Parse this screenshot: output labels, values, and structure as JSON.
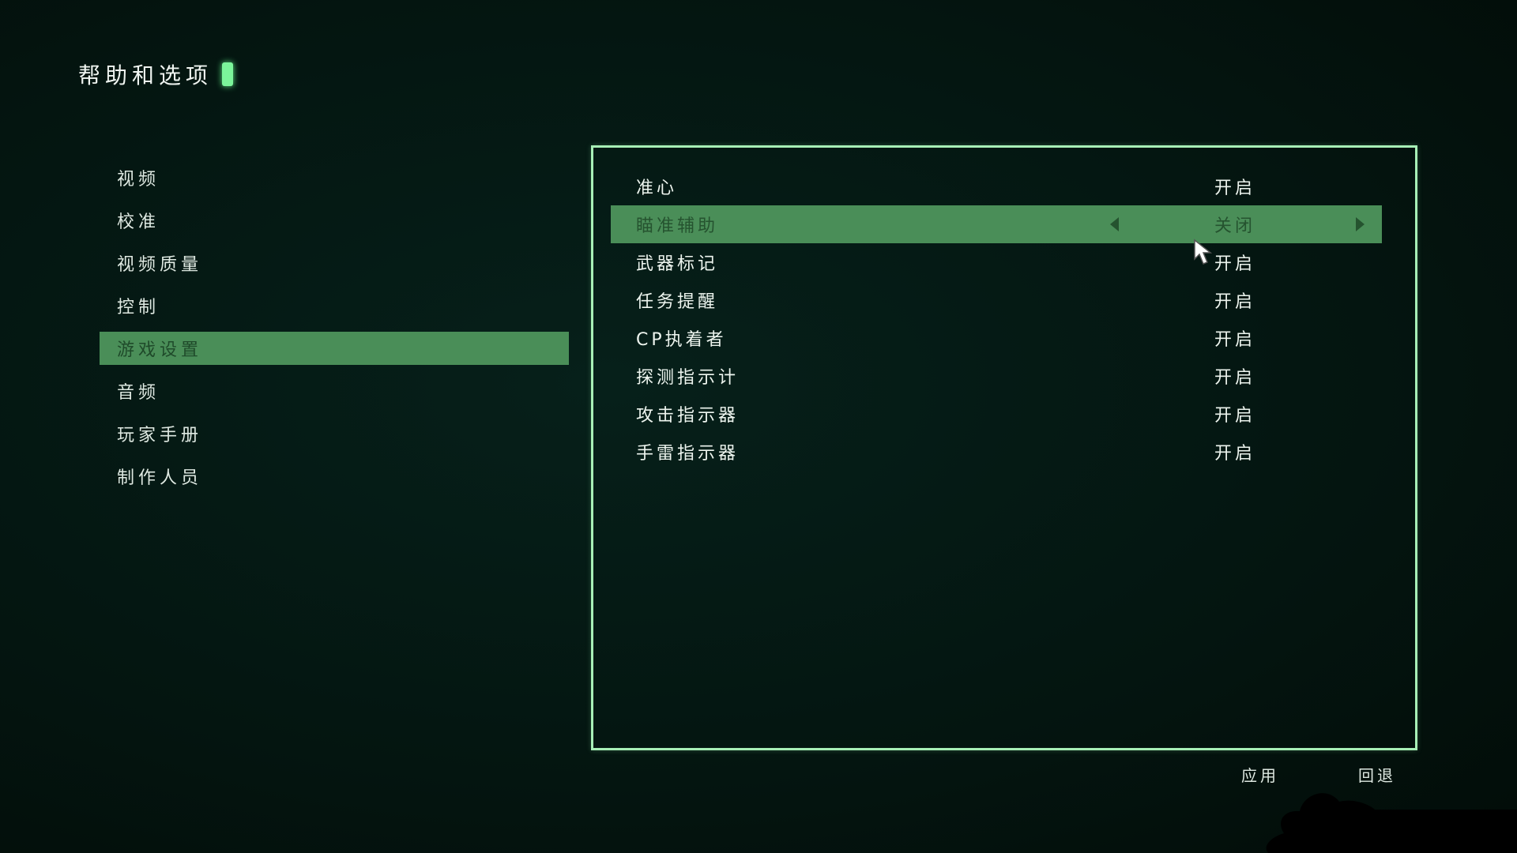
{
  "header": {
    "title": "帮助和选项"
  },
  "sidebar": {
    "items": [
      {
        "label": "视频"
      },
      {
        "label": "校准"
      },
      {
        "label": "视频质量"
      },
      {
        "label": "控制"
      },
      {
        "label": "游戏设置"
      },
      {
        "label": "音频"
      },
      {
        "label": "玩家手册"
      },
      {
        "label": "制作人员"
      }
    ],
    "selected_index": 4
  },
  "settings": {
    "rows": [
      {
        "label": "准心",
        "value": "开启"
      },
      {
        "label": "瞄准辅助",
        "value": "关闭"
      },
      {
        "label": "武器标记",
        "value": "开启"
      },
      {
        "label": "任务提醒",
        "value": "开启"
      },
      {
        "label": "CP执着者",
        "value": "开启"
      },
      {
        "label": "探测指示计",
        "value": "开启"
      },
      {
        "label": "攻击指示器",
        "value": "开启"
      },
      {
        "label": "手雷指示器",
        "value": "开启"
      }
    ],
    "selected_index": 1
  },
  "footer": {
    "apply_label": "应用",
    "back_label": "回退"
  },
  "colors": {
    "background": "#041510",
    "highlight": "#4a8e58",
    "highlight_text": "#25532f",
    "panel_border": "#a7efb6",
    "title_cursor": "#7bf59a",
    "text": "#e6efe9"
  },
  "icons": {
    "title_cursor": "blinking-block-cursor",
    "value_prev": "triangle-left",
    "value_next": "triangle-right",
    "mouse": "arrow-pointer"
  }
}
